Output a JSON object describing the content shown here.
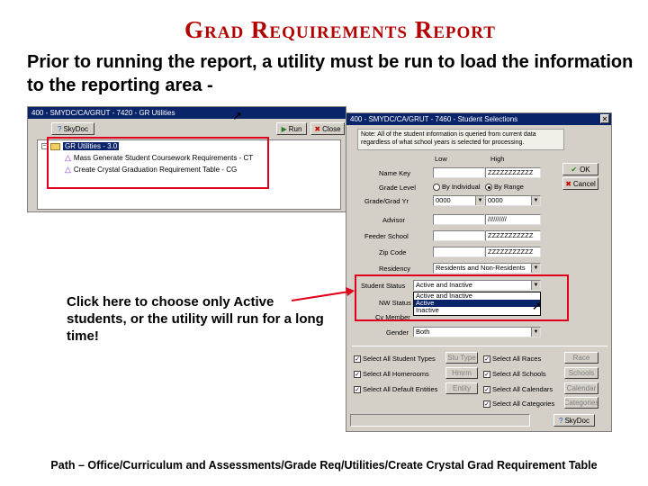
{
  "title": "Grad Requirements Report",
  "intro": "Prior to running the report, a utility must be run to load the information to the reporting area -",
  "left_window": {
    "title": "400 - SMYDC/CA/GRUT - 7420 - GR Utilities",
    "toolbar": {
      "skydoc": "SkyDoc",
      "run": "Run",
      "close": "Close"
    },
    "tree": {
      "root": "GR Utilities - 3.0",
      "items": [
        "Mass Generate Student Coursework Requirements - CT",
        "Create Crystal Graduation Requirement Table - CG"
      ]
    }
  },
  "right_window": {
    "title": "400 - SMYDC/CA/GRUT - 7460 - Student Selections",
    "note": "Note: All of the student information is queried from current data regardless of what school years is selected for processing.",
    "col_low": "Low",
    "col_high": "High",
    "ok": "OK",
    "cancel": "Cancel",
    "name_key_label": "Name Key",
    "name_key_high": "ZZZZZZZZZZZ",
    "grade_level_label": "Grade Level",
    "by_individual": "By Individual",
    "by_range": "By Range",
    "grade_grad_label": "Grade/Grad Yr",
    "grade_low": "0000",
    "grade_high": "0000",
    "advisor_label": "Advisor",
    "advisor_high": "//////////",
    "feeder_label": "Feeder School",
    "feeder_high": "ZZZZZZZZZZZ",
    "zip_label": "Zip Code",
    "zip_high": "ZZZZZZZZZZZ",
    "residency_label": "Residency",
    "residency_value": "Residents and Non-Residents",
    "student_status_label": "Student Status",
    "student_status_value": "Active and Inactive",
    "status_options": [
      "Active and Inactive",
      "Active",
      "Inactive"
    ],
    "nw_status_label": "NW Status",
    "cy_member_label": "Cy Member",
    "gender_label": "Gender",
    "gender_value": "Both",
    "checks": [
      {
        "label": "Select All Student Types",
        "button": "Stu Type"
      },
      {
        "label": "Select All Races",
        "button": "Race"
      },
      {
        "label": "Select All Homerooms",
        "button": "Hmrm"
      },
      {
        "label": "Select All Schools",
        "button": "Schools"
      },
      {
        "label": "Select All Default Entities",
        "button": "Entity"
      },
      {
        "label": "Select All Calendars",
        "button": "Calendar"
      },
      {
        "label": "Select All Categories",
        "button": "Categories"
      }
    ],
    "skydoc": "SkyDoc"
  },
  "callout": "Click here to choose only Active students, or the utility will run for a long time!",
  "footer": "Path – Office/Curriculum and Assessments/Grade Req/Utilities/Create Crystal Grad Requirement Table",
  "colors": {
    "title_red": "#b30000",
    "highlight_red": "#e0001b",
    "titlebar": "#0a246a",
    "window_bg": "#d4d0c8"
  }
}
